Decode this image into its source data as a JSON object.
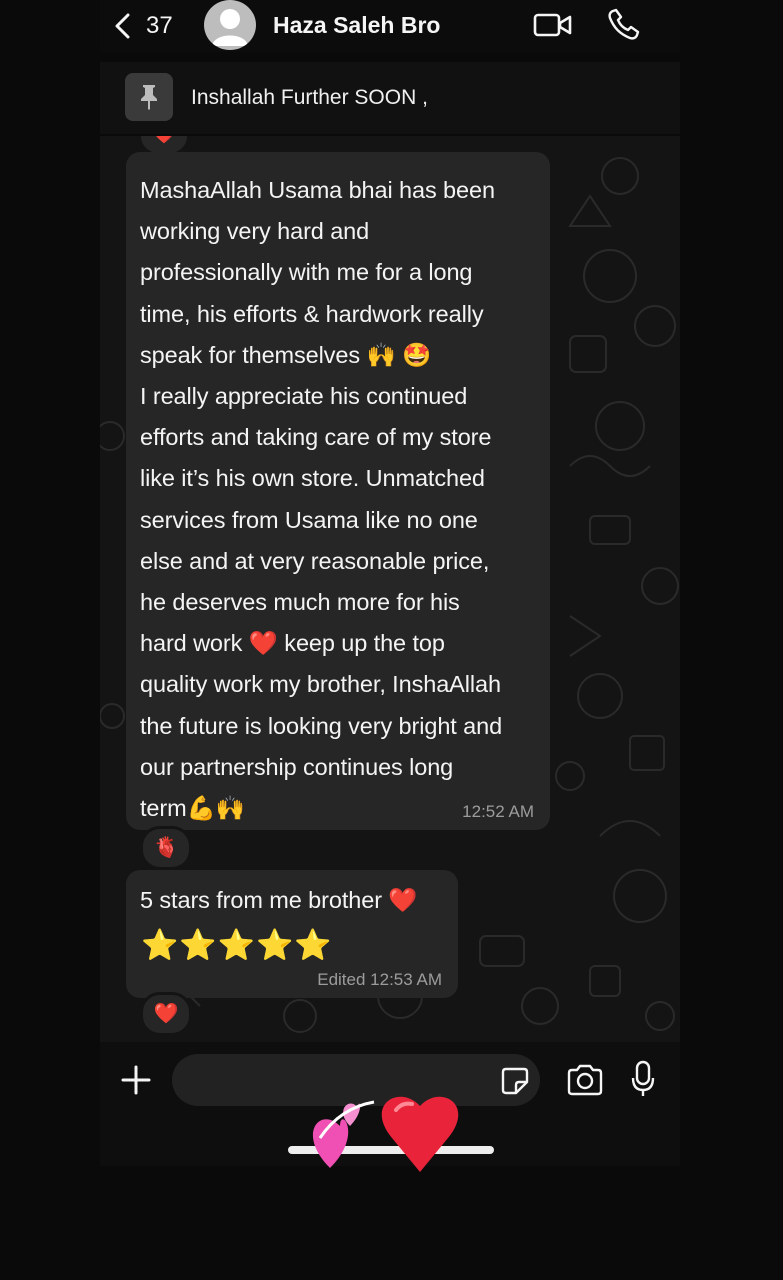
{
  "header": {
    "back_count": "37",
    "contact_name": "Haza Saleh Bro"
  },
  "pinned": {
    "text": "Inshallah Further SOON ,"
  },
  "messages": [
    {
      "text": "MashaAllah Usama bhai has been\nworking very hard and\nprofessionally with me for a long\ntime, his efforts & hardwork really\nspeak for themselves 🙌 🤩\nI really appreciate his continued\nefforts and taking care of my store\nlike it’s his own store. Unmatched\nservices from Usama like no one\nelse and at very reasonable price,\nhe deserves much more for his\nhard work ❤️ keep up the top\nquality work my brother, InshaAllah\nthe future is looking very bright and\nour partnership continues long\nterm💪🙌",
      "time": "12:52 AM",
      "reaction": "🫀"
    },
    {
      "text": "5 stars from me brother ❤️",
      "stars": "⭐⭐⭐⭐⭐",
      "time": "Edited  12:53 AM",
      "reaction": "❤️"
    }
  ],
  "top_reaction": "❤️",
  "input": {
    "placeholder": ""
  },
  "colors": {
    "bubble": "#262626",
    "wallpaper": "#141414",
    "heart": "#e8233a"
  },
  "icons": [
    "back-chevron-icon",
    "avatar-icon",
    "video-call-icon",
    "phone-icon",
    "pin-icon",
    "plus-icon",
    "sticker-icon",
    "camera-icon",
    "microphone-icon"
  ]
}
